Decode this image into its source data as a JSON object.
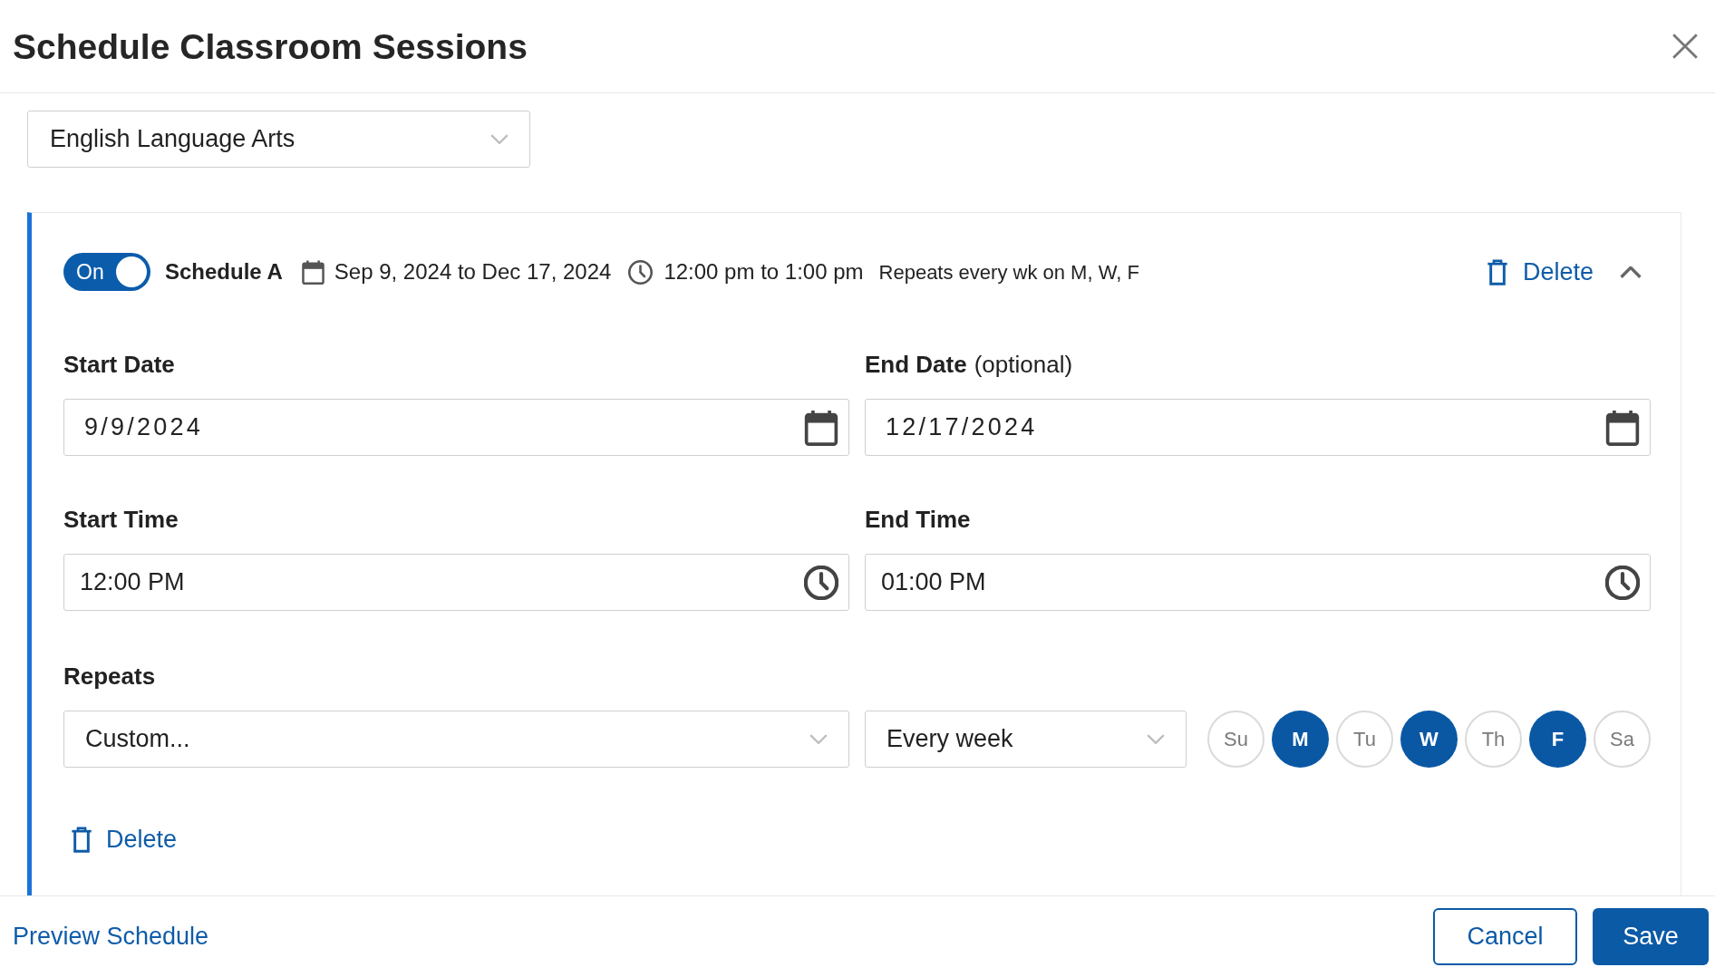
{
  "dialog": {
    "title": "Schedule Classroom Sessions"
  },
  "subject_select": {
    "value": "English Language Arts"
  },
  "schedules": [
    {
      "enabled": true,
      "toggle_label": "On",
      "name": "Schedule A",
      "date_range": "Sep 9, 2024 to Dec 17, 2024",
      "time_range": "12:00 pm to 1:00 pm",
      "repeat_summary": "Repeats every wk on M, W, F",
      "header_delete": "Delete",
      "expanded": true,
      "fields": [
        {
          "kind": "date",
          "label": "Start Date",
          "value": "9/9/2024"
        },
        {
          "kind": "date",
          "label": "End Date",
          "hint": "(optional)",
          "value": "12/17/2024"
        },
        {
          "kind": "time",
          "label": "Start Time",
          "value": "12:00 PM"
        },
        {
          "kind": "time",
          "label": "End Time",
          "value": "01:00 PM"
        }
      ],
      "repeats": {
        "label": "Repeats",
        "rule_select": {
          "value": "Custom..."
        },
        "frequency_select": {
          "value": "Every week"
        },
        "days": [
          {
            "label": "Su",
            "selected": false
          },
          {
            "label": "M",
            "selected": true
          },
          {
            "label": "Tu",
            "selected": false
          },
          {
            "label": "W",
            "selected": true
          },
          {
            "label": "Th",
            "selected": false
          },
          {
            "label": "F",
            "selected": true
          },
          {
            "label": "Sa",
            "selected": false
          }
        ]
      },
      "footer_delete": "Delete"
    }
  ],
  "footer": {
    "preview_link": "Preview Schedule",
    "buttons": [
      {
        "kind": "secondary",
        "label": "Cancel"
      },
      {
        "kind": "primary",
        "label": "Save"
      }
    ]
  }
}
